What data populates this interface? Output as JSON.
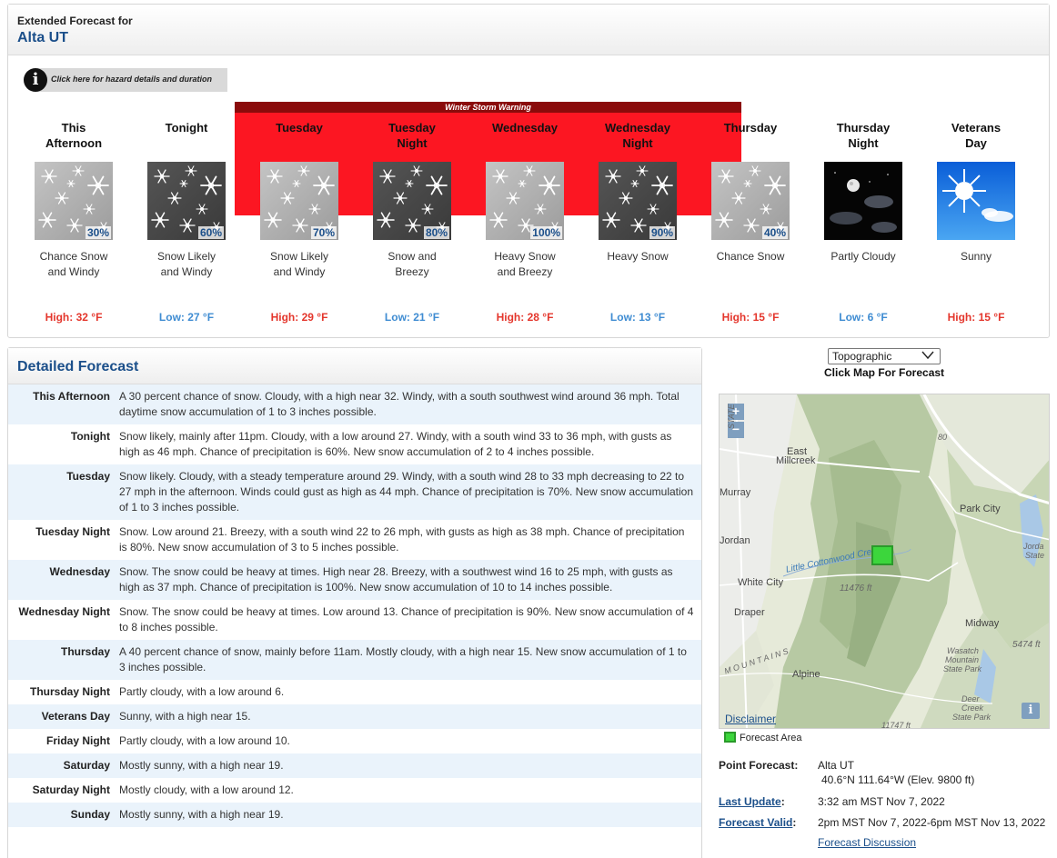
{
  "header": {
    "small_title": "Extended Forecast for",
    "location": "Alta UT"
  },
  "hazard": {
    "button_label": "Click here for hazard details and duration",
    "warning_label": "Winter Storm Warning"
  },
  "periods": [
    {
      "name_line1": "This",
      "name_line2": "Afternoon",
      "icon": "snow-day-icon",
      "pop": "30%",
      "short_line1": "Chance Snow",
      "short_line2": "and Windy",
      "temp": "High: 32 °F",
      "kind": "high"
    },
    {
      "name_line1": "Tonight",
      "name_line2": "",
      "icon": "snow-night-icon",
      "pop": "60%",
      "short_line1": "Snow Likely",
      "short_line2": "and Windy",
      "temp": "Low: 27 °F",
      "kind": "low"
    },
    {
      "name_line1": "Tuesday",
      "name_line2": "",
      "icon": "snow-day-icon",
      "pop": "70%",
      "short_line1": "Snow Likely",
      "short_line2": "and Windy",
      "temp": "High: 29 °F",
      "kind": "high"
    },
    {
      "name_line1": "Tuesday",
      "name_line2": "Night",
      "icon": "snow-night-icon",
      "pop": "80%",
      "short_line1": "Snow and",
      "short_line2": "Breezy",
      "temp": "Low: 21 °F",
      "kind": "low"
    },
    {
      "name_line1": "Wednesday",
      "name_line2": "",
      "icon": "snow-day-icon",
      "pop": "100%",
      "short_line1": "Heavy Snow",
      "short_line2": "and Breezy",
      "temp": "High: 28 °F",
      "kind": "high"
    },
    {
      "name_line1": "Wednesday",
      "name_line2": "Night",
      "icon": "snow-night-icon",
      "pop": "90%",
      "short_line1": "Heavy Snow",
      "short_line2": "",
      "temp": "Low: 13 °F",
      "kind": "low"
    },
    {
      "name_line1": "Thursday",
      "name_line2": "",
      "icon": "snow-day-icon",
      "pop": "40%",
      "short_line1": "Chance Snow",
      "short_line2": "",
      "temp": "High: 15 °F",
      "kind": "high"
    },
    {
      "name_line1": "Thursday",
      "name_line2": "Night",
      "icon": "partly-cloudy-night-icon",
      "pop": "",
      "short_line1": "Partly Cloudy",
      "short_line2": "",
      "temp": "Low: 6 °F",
      "kind": "low"
    },
    {
      "name_line1": "Veterans",
      "name_line2": "Day",
      "icon": "sunny-icon",
      "pop": "",
      "short_line1": "Sunny",
      "short_line2": "",
      "temp": "High: 15 °F",
      "kind": "high"
    }
  ],
  "detailed": {
    "title": "Detailed Forecast",
    "rows": [
      {
        "label": "This Afternoon",
        "text": "A 30 percent chance of snow. Cloudy, with a high near 32. Windy, with a south southwest wind around 36 mph. Total daytime snow accumulation of 1 to 3 inches possible."
      },
      {
        "label": "Tonight",
        "text": "Snow likely, mainly after 11pm. Cloudy, with a low around 27. Windy, with a south wind 33 to 36 mph, with gusts as high as 46 mph. Chance of precipitation is 60%. New snow accumulation of 2 to 4 inches possible."
      },
      {
        "label": "Tuesday",
        "text": "Snow likely. Cloudy, with a steady temperature around 29. Windy, with a south wind 28 to 33 mph decreasing to 22 to 27 mph in the afternoon. Winds could gust as high as 44 mph. Chance of precipitation is 70%. New snow accumulation of 1 to 3 inches possible."
      },
      {
        "label": "Tuesday Night",
        "text": "Snow. Low around 21. Breezy, with a south wind 22 to 26 mph, with gusts as high as 38 mph. Chance of precipitation is 80%. New snow accumulation of 3 to 5 inches possible."
      },
      {
        "label": "Wednesday",
        "text": "Snow. The snow could be heavy at times. High near 28. Breezy, with a southwest wind 16 to 25 mph, with gusts as high as 37 mph. Chance of precipitation is 100%. New snow accumulation of 10 to 14 inches possible."
      },
      {
        "label": "Wednesday Night",
        "text": "Snow. The snow could be heavy at times. Low around 13. Chance of precipitation is 90%. New snow accumulation of 4 to 8 inches possible."
      },
      {
        "label": "Thursday",
        "text": "A 40 percent chance of snow, mainly before 11am. Mostly cloudy, with a high near 15. New snow accumulation of 1 to 3 inches possible."
      },
      {
        "label": "Thursday Night",
        "text": "Partly cloudy, with a low around 6."
      },
      {
        "label": "Veterans Day",
        "text": "Sunny, with a high near 15."
      },
      {
        "label": "Friday Night",
        "text": "Partly cloudy, with a low around 10."
      },
      {
        "label": "Saturday",
        "text": "Mostly sunny, with a high near 19."
      },
      {
        "label": "Saturday Night",
        "text": "Mostly cloudy, with a low around 12."
      },
      {
        "label": "Sunday",
        "text": "Mostly sunny, with a high near 19."
      }
    ]
  },
  "map": {
    "basemap_selected": "Topographic",
    "click_hint": "Click Map For Forecast",
    "zoom_in": "+",
    "zoom_out": "−",
    "disclaimer": "Disclaimer",
    "legend": "Forecast Area",
    "labels": {
      "east_millcreek_1": "East",
      "east_millcreek_2": "Millcreek",
      "murray": "Murray",
      "park_city": "Park City",
      "jordan": "Jordan",
      "jordan_state_1": "Jorda",
      "jordan_state_2": "State",
      "white_city": "White City",
      "little_cottonwood": "Little Cottonwood Cre",
      "elev_11476": "11476 ft",
      "draper": "Draper",
      "midway": "Midway",
      "elev_5474": "5474 ft",
      "wasatch_1": "Wasatch",
      "wasatch_2": "Mountain",
      "wasatch_3": "State Park",
      "mountains": "M O U N T A I N S",
      "alpine": "Alpine",
      "deer_1": "Deer",
      "deer_2": "Creek",
      "deer_3": "State Park",
      "elev_11747": "11747 ft",
      "i80": "80",
      "state_st": "STATE"
    }
  },
  "point_forecast": {
    "label": "Point Forecast:",
    "location": "Alta UT",
    "coords": "40.6°N 111.64°W (Elev. 9800 ft)",
    "last_update_label": "Last Update",
    "last_update_colon": ":",
    "last_update_value": "3:32 am MST Nov 7, 2022",
    "forecast_valid_label": "Forecast Valid",
    "forecast_valid_colon": ":",
    "forecast_valid_value": "2pm MST Nov 7, 2022-6pm MST Nov 13, 2022",
    "discussion_link": "Forecast Discussion"
  },
  "colors": {
    "warning_red": "#fc1622",
    "warning_title_bg": "#8a0b0b",
    "high_temp": "#e4362c",
    "low_temp": "#3f8cd2",
    "title_blue": "#1b4f8a",
    "forecast_area_green": "#3cd63c"
  }
}
